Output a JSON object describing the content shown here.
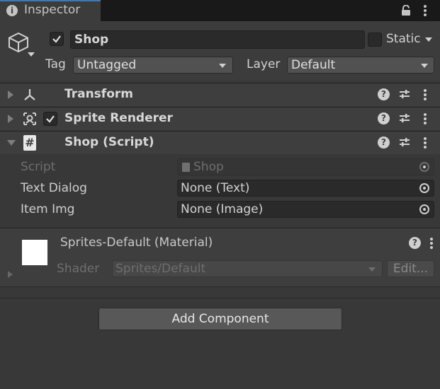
{
  "tab": {
    "title": "Inspector",
    "icon": "info-icon"
  },
  "object": {
    "name": "Shop",
    "active": true,
    "static_label": "Static",
    "static_checked": false
  },
  "tag": {
    "label": "Tag",
    "value": "Untagged"
  },
  "layer": {
    "label": "Layer",
    "value": "Default"
  },
  "components": [
    {
      "name": "Transform",
      "icon": "transform-icon",
      "has_toggle": false,
      "expanded": false
    },
    {
      "name": "Sprite Renderer",
      "icon": "sprite-renderer-icon",
      "has_toggle": true,
      "enabled": true,
      "expanded": false
    },
    {
      "name": "Shop (Script)",
      "icon": "script-icon",
      "has_toggle": false,
      "expanded": true
    }
  ],
  "script_props": {
    "script": {
      "label": "Script",
      "value": "Shop"
    },
    "text_dialog": {
      "label": "Text Dialog",
      "value": "None (Text)"
    },
    "item_img": {
      "label": "Item Img",
      "value": "None (Image)"
    }
  },
  "material": {
    "name": "Sprites-Default (Material)",
    "shader_label": "Shader",
    "shader_value": "Sprites/Default",
    "edit_label": "Edit..."
  },
  "add_component": {
    "label": "Add Component"
  },
  "colors": {
    "background": "#383838",
    "header": "#3e3e3e",
    "accent": "#3a79bb"
  }
}
